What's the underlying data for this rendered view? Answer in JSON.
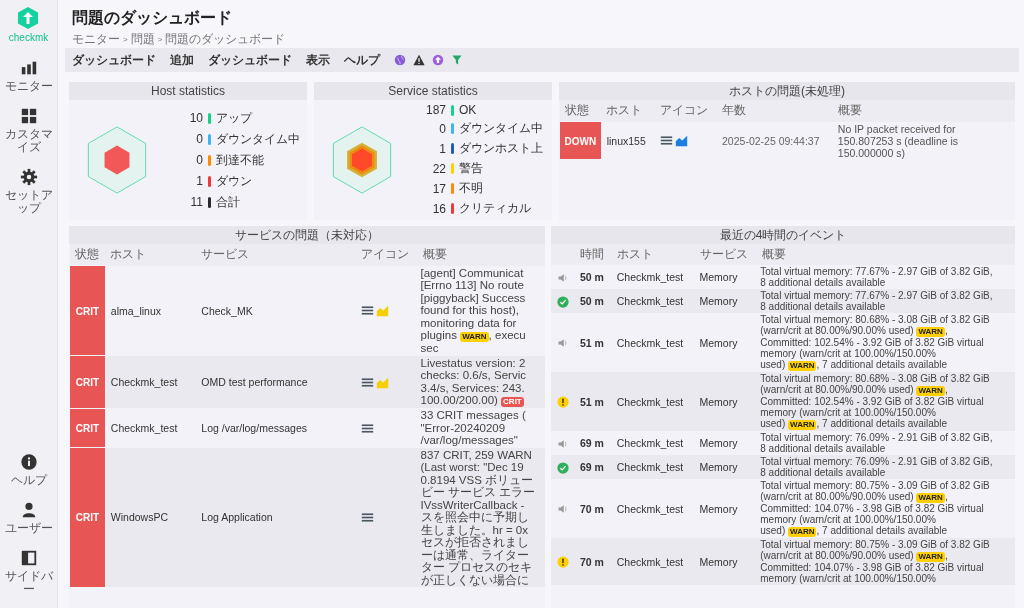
{
  "sidebar": {
    "logo_text": "checkmk",
    "items": [
      {
        "label": "モニター"
      },
      {
        "label": "カスタマイズ"
      },
      {
        "label": "セットアップ"
      }
    ],
    "bottom_items": [
      {
        "label": "ヘルプ"
      },
      {
        "label": "ユーザー"
      },
      {
        "label": "サイドバー"
      }
    ]
  },
  "page": {
    "title": "問題のダッシュボード",
    "breadcrumb": [
      "モニター",
      "問題",
      "問題のダッシュボード"
    ],
    "breadcrumb_sep": ">"
  },
  "menu": [
    "ダッシュボード",
    "追加",
    "ダッシュボード",
    "表示",
    "ヘルプ"
  ],
  "host_stats": {
    "title": "Host statistics",
    "items": [
      {
        "count": "10",
        "label": "アップ",
        "color": "#13d389"
      },
      {
        "count": "0",
        "label": "ダウンタイム中",
        "color": "#3fb4f0"
      },
      {
        "count": "0",
        "label": "到達不能",
        "color": "#ff8a00"
      },
      {
        "count": "1",
        "label": "ダウン",
        "color": "#ee3a3a"
      },
      {
        "count": "11",
        "label": "合計",
        "color": "#2a2a2a"
      }
    ]
  },
  "service_stats": {
    "title": "Service statistics",
    "items": [
      {
        "count": "187",
        "label": "OK",
        "color": "#13d389"
      },
      {
        "count": "0",
        "label": "ダウンタイム中",
        "color": "#3fb4f0"
      },
      {
        "count": "1",
        "label": "ダウンホスト上",
        "color": "#1e5fb4"
      },
      {
        "count": "22",
        "label": "警告",
        "color": "#ffd000"
      },
      {
        "count": "17",
        "label": "不明",
        "color": "#ff8a00"
      },
      {
        "count": "16",
        "label": "クリティカル",
        "color": "#ee3a3a"
      }
    ]
  },
  "host_problems": {
    "title": "ホストの問題(未処理)",
    "columns": [
      "状態",
      "ホスト",
      "アイコン",
      "年数",
      "概要"
    ],
    "rows": [
      {
        "state": "DOWN",
        "kind": "down",
        "host": "linux155",
        "has_graph": true,
        "age": "2025-02-25 09:44:37",
        "summary": "No IP packet received for 150.807253 s (deadline is 150.000000 s)"
      }
    ]
  },
  "service_problems": {
    "title": "サービスの問題（未対応）",
    "columns": [
      "状態",
      "ホスト",
      "サービス",
      "アイコン",
      "概要"
    ],
    "rows": [
      {
        "state": "CRIT",
        "kind": "crit",
        "host": "alma_linux",
        "service": "Check_MK",
        "has_graph": true,
        "summary": [
          {
            "text": "[agent] Communicat"
          },
          {
            "text": "[Errno 113] No route"
          },
          {
            "text": "[piggyback] Success"
          },
          {
            "text": "found for this host),"
          },
          {
            "text": "monitoring data for"
          },
          {
            "text": "plugins ",
            "badge": {
              "label": "WARN",
              "kind": "warn"
            },
            "after": ", execu"
          },
          {
            "text": "sec"
          }
        ]
      },
      {
        "state": "CRIT",
        "kind": "crit",
        "host": "Checkmk_test",
        "service": "OMD test performance",
        "has_graph": true,
        "summary": [
          {
            "text": "Livestatus version: 2"
          },
          {
            "text": "checks: 0.6/s, Servic"
          },
          {
            "text": "3.4/s, Services: 243."
          },
          {
            "text": "100.00/200.00) ",
            "badge": {
              "label": "CRIT",
              "kind": "crit"
            }
          }
        ]
      },
      {
        "state": "CRIT",
        "kind": "crit",
        "host": "Checkmk_test",
        "service": "Log /var/log/messages",
        "has_graph": false,
        "summary": [
          {
            "text": "33 CRIT messages ("
          },
          {
            "text": "\"Error-20240209"
          },
          {
            "text": "/var/log/messages\""
          }
        ]
      },
      {
        "state": "CRIT",
        "kind": "crit",
        "host": "WindowsPC",
        "service": "Log Application",
        "has_graph": false,
        "summary": [
          {
            "text": "837 CRIT, 259 WARN"
          },
          {
            "text": "(Last worst: \"Dec 19"
          },
          {
            "text": "0.8194 VSS ボリュー"
          },
          {
            "text": "ビー サービス エラー"
          },
          {
            "text": "IVssWriterCallback -"
          },
          {
            "text": "スを照会中に予期し"
          },
          {
            "text": "生しました。hr = 0x"
          },
          {
            "text": "セスが拒否されまし"
          },
          {
            "text": "ーは通常、ライター"
          },
          {
            "text": "ター プロセスのセキ"
          },
          {
            "text": "が正しくない場合に"
          }
        ]
      }
    ]
  },
  "events": {
    "title": "最近の4時間のイベント",
    "columns": [
      "時間",
      "ホスト",
      "サービス",
      "概要"
    ],
    "rows": [
      {
        "kind": "notify",
        "time": "50 m",
        "host": "Checkmk_test",
        "service": "Memory",
        "summary": [
          {
            "text": "Total virtual memory: 77.67% - 2.97 GiB of 3.82 GiB,"
          },
          {
            "text": "8 additional details available"
          }
        ]
      },
      {
        "kind": "ok",
        "time": "50 m",
        "host": "Checkmk_test",
        "service": "Memory",
        "summary": [
          {
            "text": "Total virtual memory: 77.67% - 2.97 GiB of 3.82 GiB,"
          },
          {
            "text": "8 additional details available"
          }
        ]
      },
      {
        "kind": "notify",
        "time": "51 m",
        "host": "Checkmk_test",
        "service": "Memory",
        "summary": [
          {
            "text": "Total virtual memory: 80.68% - 3.08 GiB of 3.82 GiB"
          },
          {
            "text": "(warn/crit at 80.00%/90.00% used) ",
            "badge": {
              "label": "WARN",
              "kind": "warn"
            },
            "after": ","
          },
          {
            "text": "Committed: 102.54% - 3.92 GiB of 3.82 GiB virtual"
          },
          {
            "text": "memory (warn/crit at 100.00%/150.00%"
          },
          {
            "text": "used) ",
            "badge": {
              "label": "WARN",
              "kind": "warn"
            },
            "after": ", 7 additional details available"
          }
        ]
      },
      {
        "kind": "warn",
        "time": "51 m",
        "host": "Checkmk_test",
        "service": "Memory",
        "summary": [
          {
            "text": "Total virtual memory: 80.68% - 3.08 GiB of 3.82 GiB"
          },
          {
            "text": "(warn/crit at 80.00%/90.00% used) ",
            "badge": {
              "label": "WARN",
              "kind": "warn"
            },
            "after": ","
          },
          {
            "text": "Committed: 102.54% - 3.92 GiB of 3.82 GiB virtual"
          },
          {
            "text": "memory (warn/crit at 100.00%/150.00%"
          },
          {
            "text": "used) ",
            "badge": {
              "label": "WARN",
              "kind": "warn"
            },
            "after": ", 7 additional details available"
          }
        ]
      },
      {
        "kind": "notify",
        "time": "69 m",
        "host": "Checkmk_test",
        "service": "Memory",
        "summary": [
          {
            "text": "Total virtual memory: 76.09% - 2.91 GiB of 3.82 GiB,"
          },
          {
            "text": "8 additional details available"
          }
        ]
      },
      {
        "kind": "ok",
        "time": "69 m",
        "host": "Checkmk_test",
        "service": "Memory",
        "summary": [
          {
            "text": "Total virtual memory: 76.09% - 2.91 GiB of 3.82 GiB,"
          },
          {
            "text": "8 additional details available"
          }
        ]
      },
      {
        "kind": "notify",
        "time": "70 m",
        "host": "Checkmk_test",
        "service": "Memory",
        "summary": [
          {
            "text": "Total virtual memory: 80.75% - 3.09 GiB of 3.82 GiB"
          },
          {
            "text": "(warn/crit at 80.00%/90.00% used) ",
            "badge": {
              "label": "WARN",
              "kind": "warn"
            },
            "after": ","
          },
          {
            "text": "Committed: 104.07% - 3.98 GiB of 3.82 GiB virtual"
          },
          {
            "text": "memory (warn/crit at 100.00%/150.00%"
          },
          {
            "text": "used) ",
            "badge": {
              "label": "WARN",
              "kind": "warn"
            },
            "after": ", 7 additional details available"
          }
        ]
      },
      {
        "kind": "warn",
        "time": "70 m",
        "host": "Checkmk_test",
        "service": "Memory",
        "summary": [
          {
            "text": "Total virtual memory: 80.75% - 3.09 GiB of 3.82 GiB"
          },
          {
            "text": "(warn/crit at 80.00%/90.00% used) ",
            "badge": {
              "label": "WARN",
              "kind": "warn"
            },
            "after": ","
          },
          {
            "text": "Committed: 104.07% - 3.98 GiB of 3.82 GiB virtual"
          },
          {
            "text": "memory (warn/crit at 100.00%/150.00%"
          }
        ]
      }
    ]
  }
}
